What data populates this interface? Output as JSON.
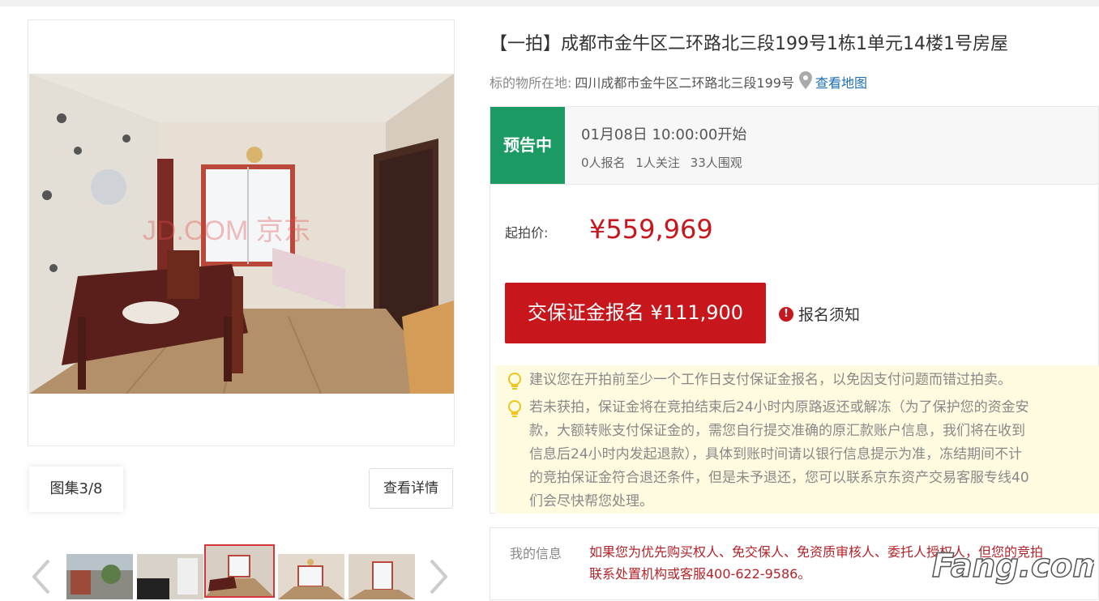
{
  "gallery": {
    "count_label": "图集3/8",
    "detail_button": "查看详情",
    "watermark_text": "JD.COM 京东"
  },
  "listing": {
    "title": "【一拍】成都市金牛区二环路北三段199号1栋1单元14楼1号房屋",
    "address_label": "标的物所在地:",
    "address_value": "四川成都市金牛区二环路北三段199号",
    "map_link": "查看地图"
  },
  "status": {
    "badge": "预告中",
    "start_time": "01月08日 10:00:00开始",
    "signups": "0人报名",
    "follows": "1人关注",
    "views": "33人围观"
  },
  "price": {
    "label": "起拍价:",
    "value": "¥559,969",
    "deposit_button": "交保证金报名 ¥111,900",
    "notice_link": "报名须知"
  },
  "tips": [
    "建议您在开拍前至少一个工作日支付保证金报名，以免因支付问题而错过拍卖。",
    "若未获拍，保证金将在竞拍结束后24小时内原路返还或解冻（为了保护您的资金安",
    "款，大额转账支付保证金的，需您自行提交准确的原汇款账户信息，我们将在收到",
    "信息后24小时内发起退款），具体到账时间请以银行信息提示为准，冻结期间不计",
    "的竞拍保证金符合退还条件，但是未予退还，您可以联系京东资产交易客服专线40",
    "们会尽快帮您处理。"
  ],
  "my_info": {
    "label": "我的信息",
    "line1": "如果您为优先购买权人、免交保人、免资质审核人、委托人授权人，但您的竞拍",
    "line2": "联系处置机构或客服400-622-9586。"
  },
  "site_watermark": "Fang.com",
  "colors": {
    "accent_red": "#c8161d",
    "status_green": "#1b9a64",
    "link_blue": "#1a6fb5",
    "tip_bg": "#fffbe0"
  }
}
